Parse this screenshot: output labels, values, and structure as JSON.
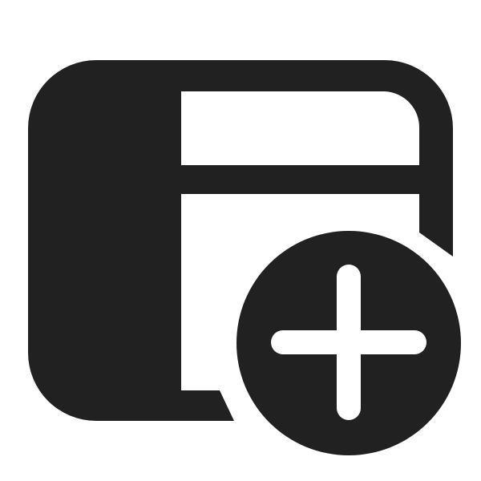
{
  "icon": {
    "name": "panel-left-add-icon",
    "foreground": "#212121",
    "background": "#ffffff"
  }
}
